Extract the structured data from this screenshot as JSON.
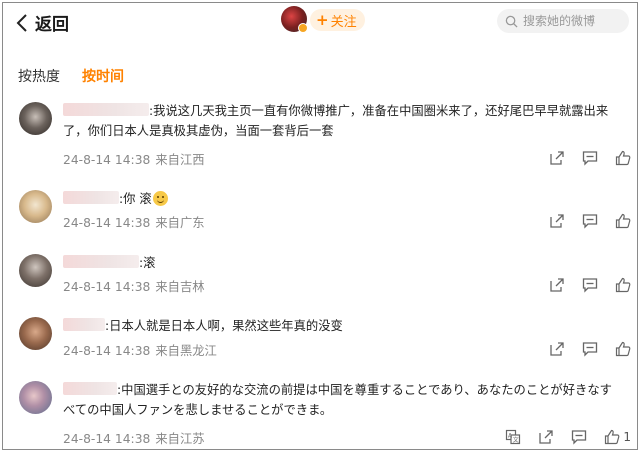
{
  "header": {
    "back_label": "返回",
    "follow_label": "关注",
    "search_placeholder": "搜索她的微博"
  },
  "tabs": [
    {
      "label": "按热度",
      "active": false
    },
    {
      "label": "按时间",
      "active": true
    }
  ],
  "colors": {
    "accent": "#ff8200",
    "meta_text": "#888888",
    "follow_bg": "#fff1e0"
  },
  "comments": [
    {
      "text": ":我说这几天我主页一直有你微博推广，准备在中国圈米来了，还好尾巴早早就露出来了，你们日本人是真极其虚伪，当面一套背后一套",
      "date": "24-8-14 14:38",
      "location": "来自江西"
    },
    {
      "text": ":你 滚",
      "emoji": "smile-emoji",
      "date": "24-8-14 14:38",
      "location": "来自广东"
    },
    {
      "text": ":滚",
      "date": "24-8-14 14:38",
      "location": "来自吉林"
    },
    {
      "text": ":日本人就是日本人啊，果然这些年真的没变",
      "date": "24-8-14 14:38",
      "location": "来自黑龙江"
    },
    {
      "text": ":中国選手との友好的な交流の前提は中国を尊重することであり、あなたのことが好きなすべての中国人ファンを悲しませることができま。",
      "date": "24-8-14 14:38",
      "location": "来自江苏",
      "like_count": "1"
    }
  ]
}
